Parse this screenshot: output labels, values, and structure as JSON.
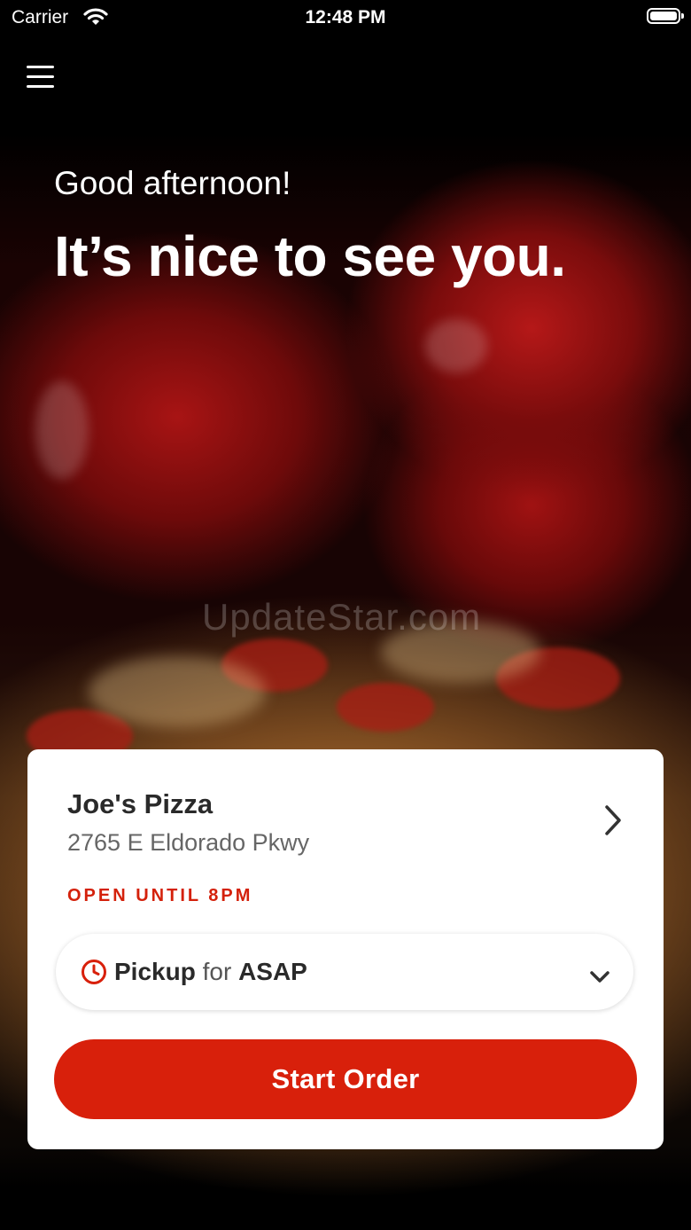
{
  "status_bar": {
    "carrier": "Carrier",
    "time": "12:48 PM"
  },
  "hero": {
    "greeting": "Good afternoon!",
    "headline": "It’s nice to see you.",
    "watermark": "UpdateStar.com"
  },
  "store": {
    "name": "Joe's Pizza",
    "address": "2765 E Eldorado Pkwy",
    "hours": "OPEN UNTIL 8PM"
  },
  "order_mode": {
    "mode": "Pickup",
    "connector": "for",
    "time": "ASAP"
  },
  "actions": {
    "start_order": "Start Order"
  },
  "colors": {
    "accent": "#d8200b",
    "hours_text": "#d4210b"
  },
  "icons": [
    "wifi-icon",
    "battery-icon",
    "menu-icon",
    "chevron-right-icon",
    "clock-icon",
    "chevron-down-icon"
  ]
}
